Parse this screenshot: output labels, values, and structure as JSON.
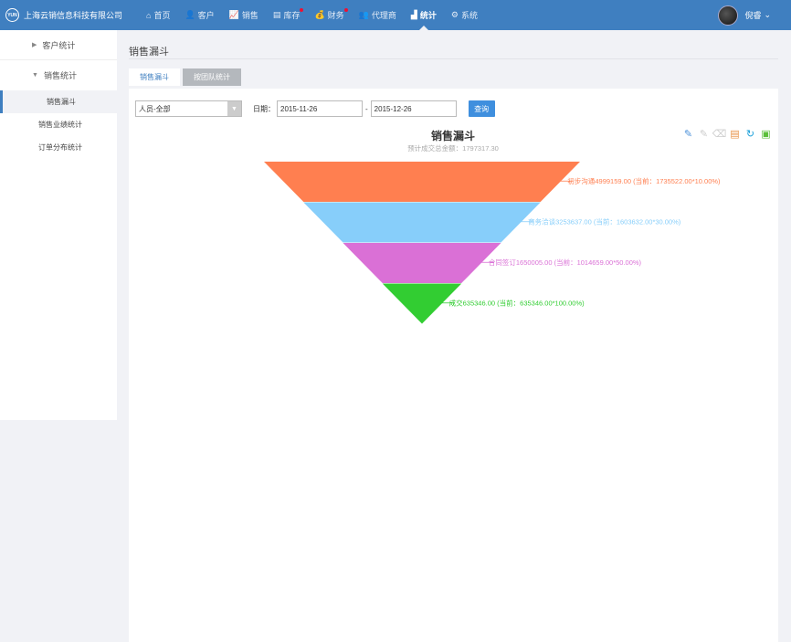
{
  "brand": {
    "logo": "YUN",
    "name": "上海云销信息科技有限公司"
  },
  "nav": [
    {
      "label": "首页",
      "icon": "⌂",
      "dot": false,
      "active": false
    },
    {
      "label": "客户",
      "icon": "👤",
      "dot": false,
      "active": false
    },
    {
      "label": "销售",
      "icon": "📈",
      "dot": false,
      "active": false
    },
    {
      "label": "库存",
      "icon": "▤",
      "dot": true,
      "active": false
    },
    {
      "label": "财务",
      "icon": "💰",
      "dot": true,
      "active": false
    },
    {
      "label": "代理商",
      "icon": "👥",
      "dot": false,
      "active": false
    },
    {
      "label": "统计",
      "icon": "▟",
      "dot": false,
      "active": true
    },
    {
      "label": "系统",
      "icon": "⚙",
      "dot": false,
      "active": false
    }
  ],
  "user": {
    "name": "倪睿",
    "caret": "⌄"
  },
  "sidebar": {
    "group1": {
      "label": "客户统计",
      "arrow": "▶"
    },
    "group2": {
      "label": "销售统计",
      "arrow": "▼"
    },
    "items": [
      {
        "label": "销售漏斗"
      },
      {
        "label": "销售业绩统计"
      },
      {
        "label": "订单分布统计"
      }
    ]
  },
  "page": {
    "title": "销售漏斗"
  },
  "tabs": [
    {
      "label": "销售漏斗"
    },
    {
      "label": "按团队统计"
    }
  ],
  "filter": {
    "person": "人员-全部",
    "date_label": "日期：",
    "start": "2015-11-26",
    "dash": "-",
    "end": "2015-12-26",
    "query": "查询"
  },
  "toolbox": [
    {
      "icon": "✎",
      "color": "#4a90d9",
      "name": "mark-icon"
    },
    {
      "icon": "✎",
      "color": "#cccccc",
      "name": "mark-undo-icon"
    },
    {
      "icon": "⌫",
      "color": "#cccccc",
      "name": "mark-clear-icon"
    },
    {
      "icon": "▤",
      "color": "#e8934a",
      "name": "data-view-icon"
    },
    {
      "icon": "↻",
      "color": "#1a9fd9",
      "name": "restore-icon"
    },
    {
      "icon": "▣",
      "color": "#5bbf3a",
      "name": "save-image-icon"
    }
  ],
  "chart_data": {
    "type": "funnel",
    "title": "销售漏斗",
    "subtitle": "预计成交总金额：1797317.30",
    "stages": [
      {
        "label": "初步沟通4999159.00 (当前：1735522.00*10.00%)",
        "percent": 100,
        "color": "#ff7f50"
      },
      {
        "label": "商务洽谈3253637.00 (当前：1603632.00*30.00%)",
        "percent": 66.7,
        "color": "#87cefa"
      },
      {
        "label": "合同签订1650005.00 (当前：1014659.00*50.00%)",
        "percent": 33.3,
        "color": "#da70d6"
      },
      {
        "label": "成交635346.00 (当前：635346.00*100.00%)",
        "percent": 0,
        "color": "#32cd32"
      }
    ]
  }
}
